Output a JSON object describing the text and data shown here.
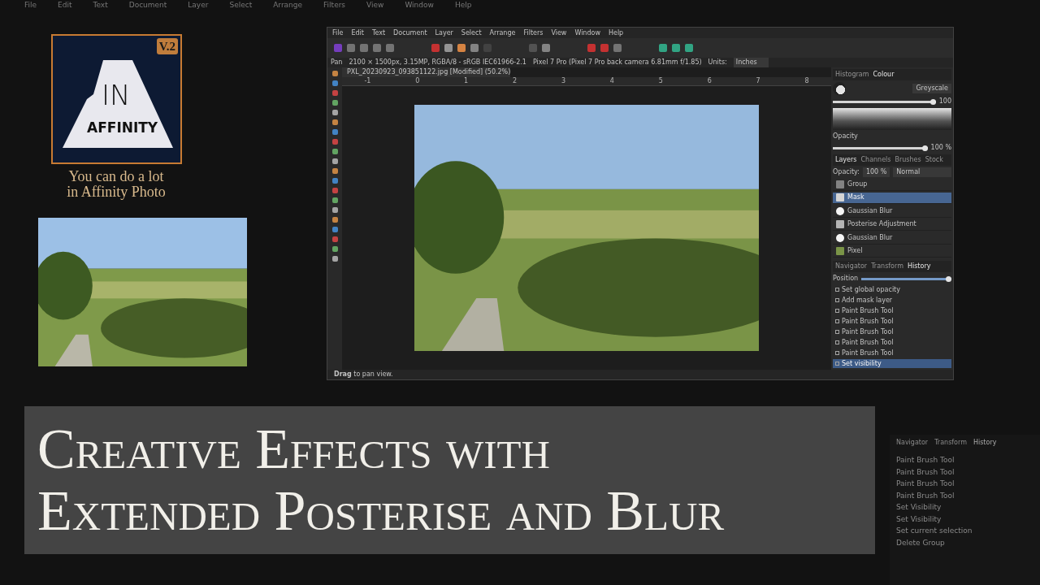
{
  "background_app": {
    "menu": [
      "File",
      "Edit",
      "Text",
      "Document",
      "Layer",
      "Select",
      "Arrange",
      "Filters",
      "View",
      "Window",
      "Help"
    ],
    "history_tabs": [
      {
        "label": "Navigator",
        "selected": false
      },
      {
        "label": "Transform",
        "selected": false
      },
      {
        "label": "History",
        "selected": true
      }
    ],
    "history_items": [
      "Paint Brush Tool",
      "Paint Brush Tool",
      "Paint Brush Tool",
      "Paint Brush Tool",
      "Set Visibility",
      "Set Visibility",
      "Set current selection",
      "Delete Group"
    ]
  },
  "logo": {
    "badge": "V.2",
    "big": "IN",
    "word": "AFFINITY",
    "caption": [
      "You can do a lot",
      "in Affinity Photo"
    ]
  },
  "app_window": {
    "menu": [
      "File",
      "Edit",
      "Text",
      "Document",
      "Layer",
      "Select",
      "Arrange",
      "Filters",
      "View",
      "Window",
      "Help"
    ],
    "context_bar": {
      "tool": "Pan",
      "info": "2100 × 1500px, 3.15MP, RGBA/8 - sRGB IEC61966-2.1",
      "camera": "Pixel 7 Pro (Pixel 7 Pro back camera 6.81mm f/1.85)",
      "units_label": "Units:",
      "units": "Inches"
    },
    "document_tab": "PXL_20230923_093851122.jpg [Modified] (50.2%)",
    "ruler": [
      "-1",
      "0",
      "1",
      "2",
      "3",
      "4",
      "5",
      "6",
      "7",
      "8"
    ],
    "status": "**Drag** to pan view.",
    "panel": {
      "colour_tabs": [
        {
          "label": "Histogram",
          "selected": false
        },
        {
          "label": "Colour",
          "selected": true
        }
      ],
      "colour_mode": "Greyscale",
      "value_slider": {
        "level": 1
      },
      "value": "100",
      "opacity_label": "Opacity",
      "opacity_slider": {
        "level": 1
      },
      "opacity": "100 %",
      "layer_tabs": [
        {
          "label": "Layers",
          "selected": true
        },
        {
          "label": "Channels",
          "selected": false
        },
        {
          "label": "Brushes",
          "selected": false
        },
        {
          "label": "Stock",
          "selected": false
        }
      ],
      "layer_opacity_label": "Opacity:",
      "layer_opacity": "100 %",
      "blend": "Normal",
      "layers": [
        {
          "name": "Group",
          "kind": "group",
          "selected": false
        },
        {
          "name": "Mask",
          "kind": "mask",
          "selected": true
        },
        {
          "name": "Gaussian Blur",
          "kind": "blur",
          "selected": false
        },
        {
          "name": "Posterise Adjustment",
          "kind": "adjust",
          "selected": false
        },
        {
          "name": "Gaussian Blur",
          "kind": "blur",
          "selected": false
        },
        {
          "name": "Pixel",
          "kind": "pixel",
          "selected": false
        }
      ],
      "history_tabs": [
        {
          "label": "Navigator",
          "selected": false
        },
        {
          "label": "Transform",
          "selected": false
        },
        {
          "label": "History",
          "selected": true
        }
      ],
      "position_label": "Position",
      "position_slider": {
        "level": 1
      },
      "history": [
        {
          "label": "Set global opacity",
          "selected": false
        },
        {
          "label": "Add mask layer",
          "selected": false
        },
        {
          "label": "Paint Brush Tool",
          "selected": false
        },
        {
          "label": "Paint Brush Tool",
          "selected": false
        },
        {
          "label": "Paint Brush Tool",
          "selected": false
        },
        {
          "label": "Paint Brush Tool",
          "selected": false
        },
        {
          "label": "Paint Brush Tool",
          "selected": false
        },
        {
          "label": "Set visibility",
          "selected": true
        }
      ]
    }
  },
  "title": [
    "Creative Effects with",
    "Extended Posterise and Blur"
  ]
}
